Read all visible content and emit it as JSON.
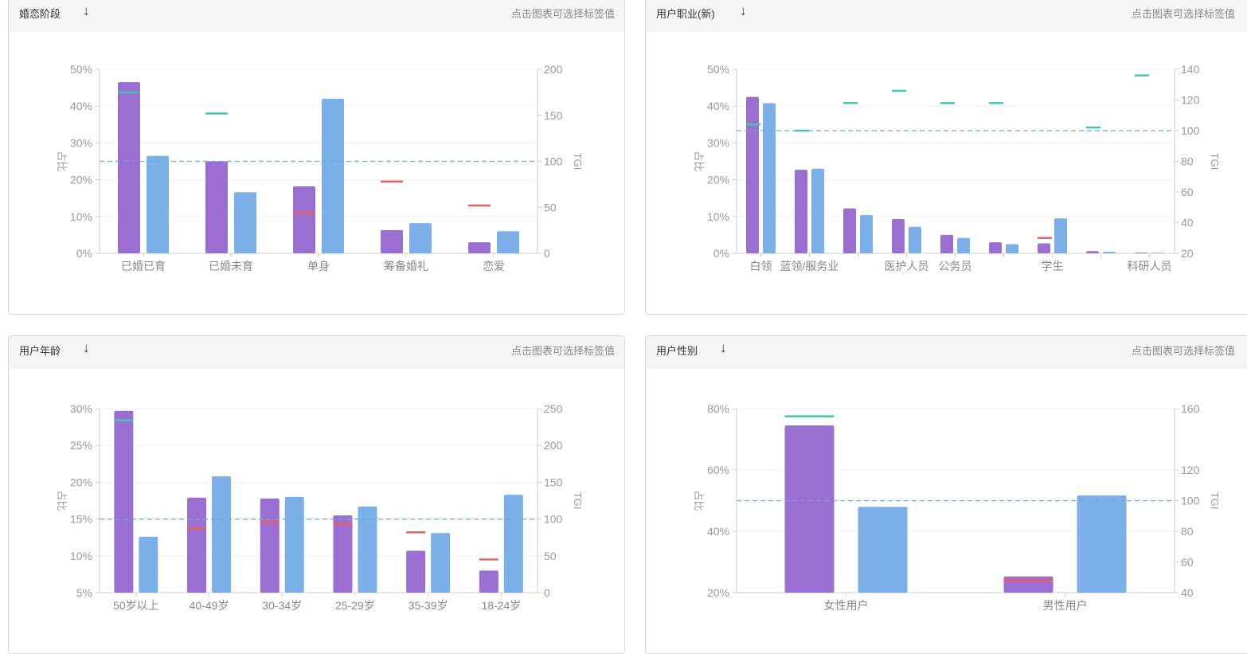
{
  "hint_text": "点击图表可选择标签值",
  "panels": [
    {
      "id": "marital",
      "title": "婚恋阶段",
      "sort_icon": "arrow-down-icon",
      "ylabel": "占比",
      "y2label": "TGI",
      "chart_data": {
        "type": "bar",
        "categories": [
          "已婚已育",
          "已婚未育",
          "单身",
          "筹备婚礼",
          "恋爱"
        ],
        "ylim": [
          0,
          50
        ],
        "yticks": [
          "0%",
          "10%",
          "20%",
          "30%",
          "40%",
          "50%"
        ],
        "y2lim": [
          0,
          200
        ],
        "y2ticks": [
          "0",
          "50",
          "100",
          "150",
          "200"
        ],
        "reference_tgi": 100,
        "series": [
          {
            "color": "#9b6fd1",
            "values": [
              46.5,
              25,
              18.2,
              6.3,
              3
            ]
          },
          {
            "color": "#7aafe8",
            "values": [
              26.5,
              16.6,
              42,
              8.2,
              6
            ]
          }
        ],
        "tgi": [
          175,
          152,
          44,
          78,
          52
        ]
      }
    },
    {
      "id": "occupation",
      "title": "用户职业(新)",
      "sort_icon": "arrow-down-icon",
      "ylabel": "占比",
      "y2label": "TGI",
      "chart_data": {
        "type": "bar",
        "categories": [
          "白领",
          "蓝领/服务业",
          "",
          "医护人员",
          "公务员",
          "",
          "学生",
          "",
          "科研人员"
        ],
        "ylim": [
          0,
          50
        ],
        "yticks": [
          "0%",
          "10%",
          "20%",
          "30%",
          "40%",
          "50%"
        ],
        "y2lim": [
          20,
          140
        ],
        "y2ticks": [
          "20",
          "40",
          "60",
          "80",
          "100",
          "120",
          "140"
        ],
        "reference_tgi": 100,
        "series": [
          {
            "color": "#9b6fd1",
            "values": [
              42.5,
              22.7,
              12.2,
              9.3,
              5,
              3,
              2.7,
              0.6,
              0.2
            ]
          },
          {
            "color": "#7aafe8",
            "values": [
              40.8,
              23,
              10.4,
              7.2,
              4.2,
              2.5,
              9.5,
              0.4,
              0.15
            ]
          }
        ],
        "tgi": [
          104,
          100,
          118,
          126,
          118,
          118,
          30,
          102,
          136
        ]
      }
    },
    {
      "id": "age",
      "title": "用户年龄",
      "sort_icon": "arrow-down-icon",
      "ylabel": "占比",
      "y2label": "TGI",
      "chart_data": {
        "type": "bar",
        "categories": [
          "50岁以上",
          "40-49岁",
          "30-34岁",
          "25-29岁",
          "35-39岁",
          "18-24岁"
        ],
        "ylim": [
          5,
          30
        ],
        "yticks": [
          "5%",
          "10%",
          "15%",
          "20%",
          "25%",
          "30%"
        ],
        "y2lim": [
          0,
          250
        ],
        "y2ticks": [
          "0",
          "50",
          "100",
          "150",
          "200",
          "250"
        ],
        "reference_tgi": 100,
        "series": [
          {
            "color": "#9b6fd1",
            "values": [
              29.7,
              17.9,
              17.8,
              15.5,
              10.7,
              8
            ]
          },
          {
            "color": "#7aafe8",
            "values": [
              12.6,
              20.8,
              18,
              16.7,
              13.1,
              18.3
            ]
          }
        ],
        "tgi": [
          234,
          87,
          96,
          93,
          82,
          45
        ]
      }
    },
    {
      "id": "gender",
      "title": "用户性别",
      "sort_icon": "arrow-down-icon",
      "ylabel": "占比",
      "y2label": "TGI",
      "chart_data": {
        "type": "bar",
        "categories": [
          "女性用户",
          "男性用户"
        ],
        "ylim": [
          20,
          80
        ],
        "yticks": [
          "20%",
          "40%",
          "60%",
          "80%"
        ],
        "y2lim": [
          40,
          160
        ],
        "y2ticks": [
          "40",
          "60",
          "80",
          "100",
          "120",
          "160"
        ],
        "y2tick_values": [
          40,
          60,
          80,
          100,
          120,
          160
        ],
        "reference_tgi": 100,
        "series": [
          {
            "color": "#9b6fd1",
            "values": [
              74.5,
              25.3
            ]
          },
          {
            "color": "#7aafe8",
            "values": [
              48,
              51.7
            ]
          }
        ],
        "tgi": [
          155,
          48
        ]
      }
    }
  ]
}
